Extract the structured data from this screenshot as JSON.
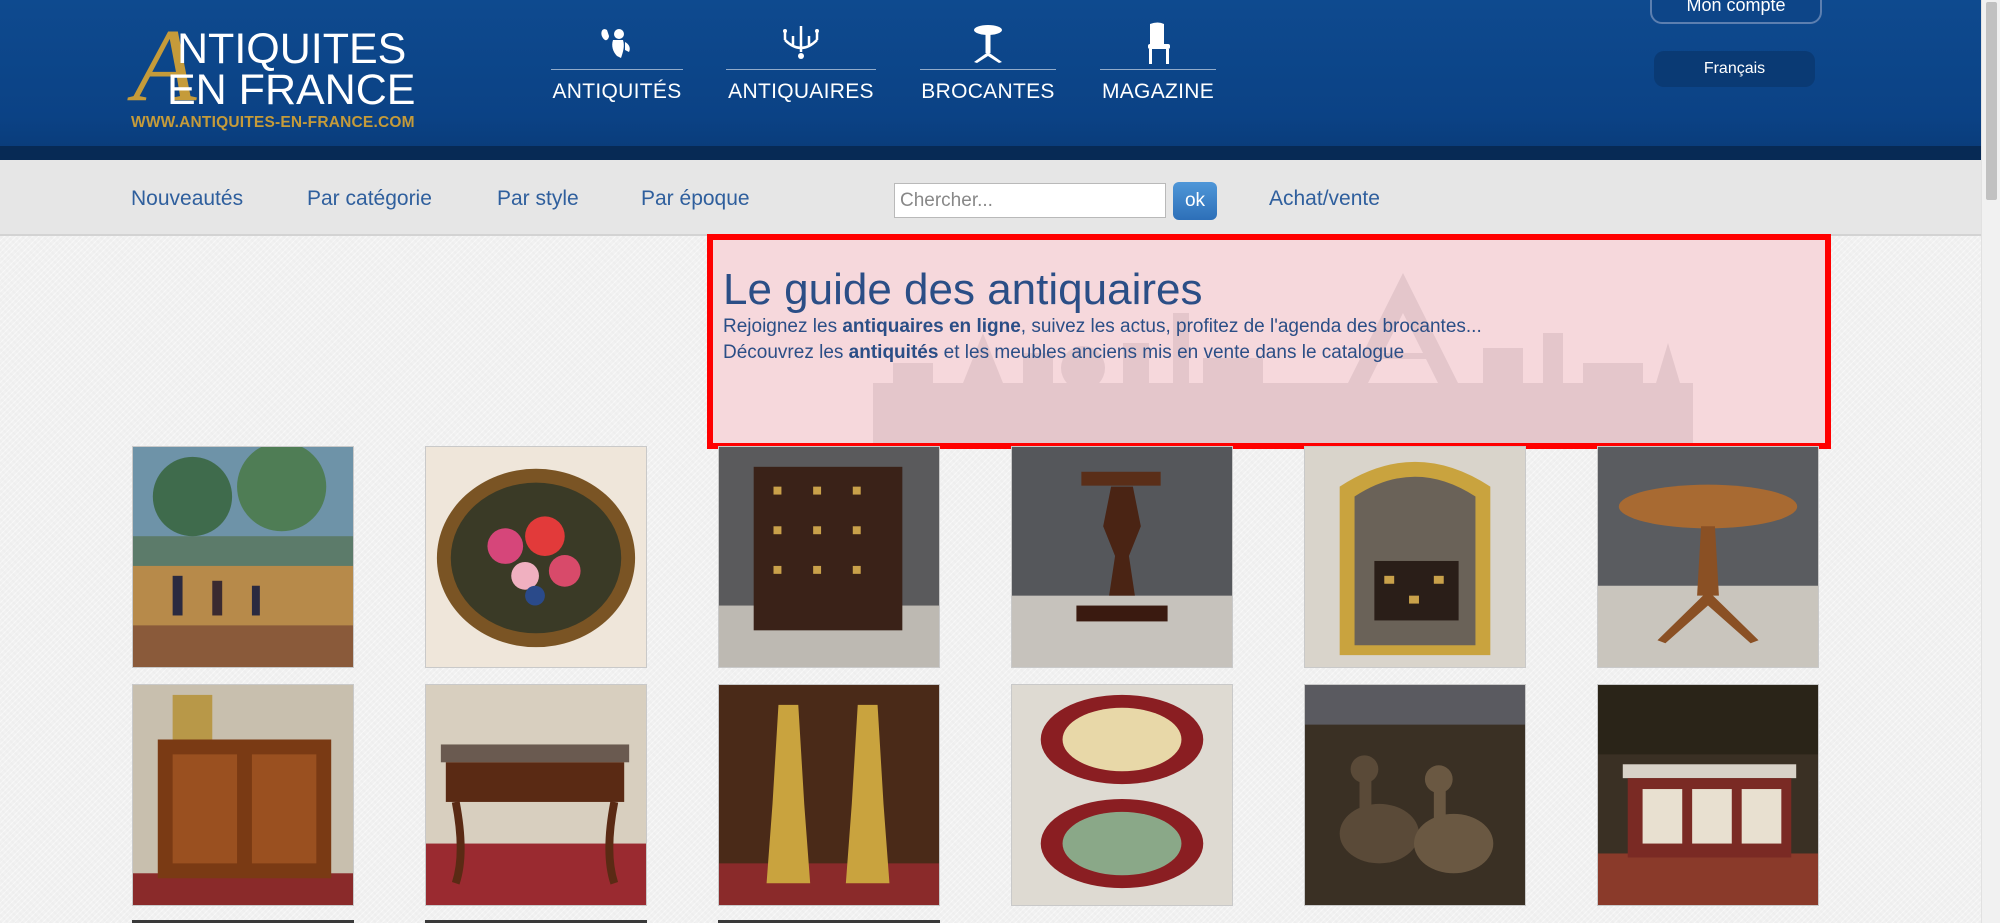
{
  "logo": {
    "big_letter": "A",
    "line1": "NTIQUITES",
    "line2": "EN FRANCE",
    "url": "WWW.ANTIQUITES-EN-FRANCE.COM",
    "accent_color": "#c59b3a"
  },
  "main_nav": [
    {
      "label": "ANTIQUITÉS",
      "icon": "cherub-icon"
    },
    {
      "label": "ANTIQUAIRES",
      "icon": "chandelier-icon"
    },
    {
      "label": "BROCANTES",
      "icon": "pedestal-table-icon"
    },
    {
      "label": "MAGAZINE",
      "icon": "chair-icon"
    }
  ],
  "account": {
    "label": "Mon compte"
  },
  "language": {
    "label": "Français"
  },
  "subnav": {
    "links": [
      "Nouveautés",
      "Par catégorie",
      "Par style",
      "Par époque"
    ],
    "search_placeholder": "Chercher...",
    "search_button": "ok",
    "buy_sell": "Achat/vente"
  },
  "hero": {
    "title": "Le guide des antiquaires",
    "line1_pre": "Rejoignez les ",
    "line1_bold": "antiquaires en ligne",
    "line1_post": ", suivez les actus, profitez de l'agenda des brocantes...",
    "line2_pre": "Découvrez les ",
    "line2_bold": "antiquités",
    "line2_post": " et les meubles anciens mis en vente dans le catalogue"
  },
  "products": [
    {
      "name": "impressionist-painting"
    },
    {
      "name": "oval-floral-painting"
    },
    {
      "name": "dark-wood-cabinet"
    },
    {
      "name": "wooden-pedestal"
    },
    {
      "name": "gilt-mirror"
    },
    {
      "name": "round-pedestal-table"
    },
    {
      "name": "marquetry-cabinet-clock"
    },
    {
      "name": "carved-console-table"
    },
    {
      "name": "gilt-candlesticks"
    },
    {
      "name": "decorated-plates"
    },
    {
      "name": "bronze-ducks"
    },
    {
      "name": "painted-buffet"
    }
  ],
  "colors": {
    "header": "#0e4a8f",
    "link": "#2f5f9d",
    "hero_text": "#2b4e86",
    "highlight_border": "#ff0000"
  }
}
